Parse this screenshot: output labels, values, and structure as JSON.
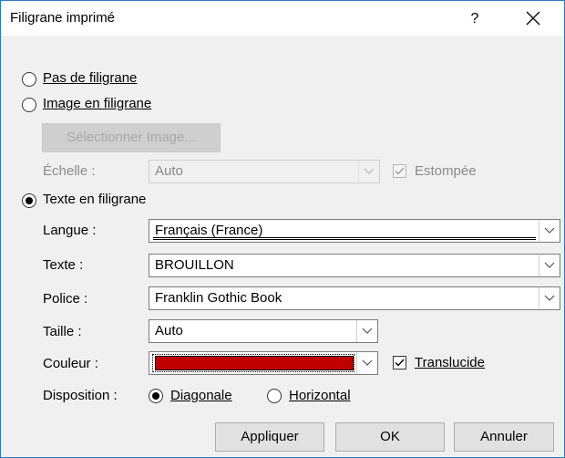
{
  "window": {
    "title": "Filigrane imprimé",
    "help": "?"
  },
  "options": {
    "no_watermark": "Pas de filigrane",
    "picture_watermark": "Image en filigrane",
    "select_picture": "Sélectionner Image...",
    "scale_label": "Échelle :",
    "scale_value": "Auto",
    "washout_label": "Estompée",
    "text_watermark": "Texte en filigrane"
  },
  "text_fields": {
    "language_label": "Langue :",
    "language_value": "Français (France)",
    "text_label": "Texte :",
    "text_value": "BROUILLON",
    "font_label": "Police :",
    "font_value": "Franklin Gothic Book",
    "size_label": "Taille :",
    "size_value": "Auto",
    "color_label": "Couleur :",
    "color_value": "#c00000",
    "translucent_label": "Translucide",
    "layout_label": "Disposition :",
    "diagonal_label": "Diagonale",
    "horizontal_label": "Horizontal"
  },
  "state": {
    "selected_option": "Texte en filigrane",
    "layout_selected": "Diagonale",
    "translucent_checked": true,
    "washout_checked": true
  },
  "buttons": {
    "apply": "Appliquer",
    "ok": "OK",
    "cancel": "Annuler"
  }
}
